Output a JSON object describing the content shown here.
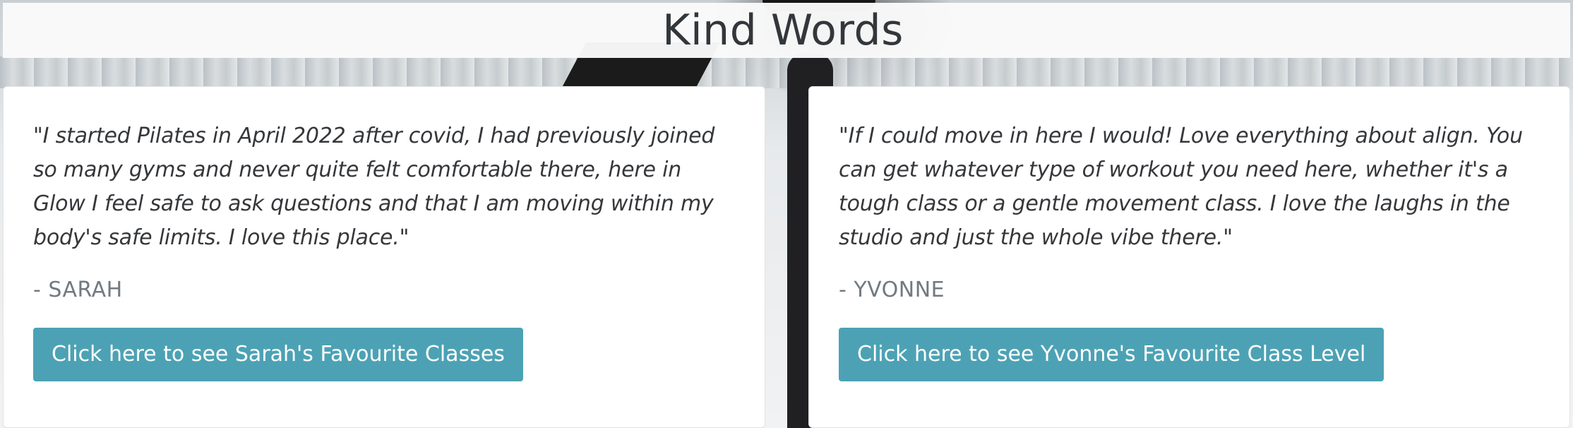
{
  "header": {
    "title": "Kind Words"
  },
  "testimonials": [
    {
      "quote": "\"I started Pilates in April 2022 after covid, I had previously joined so many gyms and never quite felt comfortable there, here in Glow I feel safe to ask questions and that I am moving within my body's safe limits. I love this place.\"",
      "author": "- SARAH",
      "button_label": "Click here to see Sarah's Favourite Classes"
    },
    {
      "quote": "\"If I could move in here I would! Love everything about align. You can get whatever type of workout you need here, whether it's a tough class or a gentle movement class. I love the laughs in the studio and just the whole vibe there.\"",
      "author": "- YVONNE",
      "button_label": "Click here to see Yvonne's Favourite Class Level"
    }
  ],
  "colors": {
    "button_bg": "#4ca2b4",
    "title_text": "#33363a",
    "author_text": "#727981"
  }
}
